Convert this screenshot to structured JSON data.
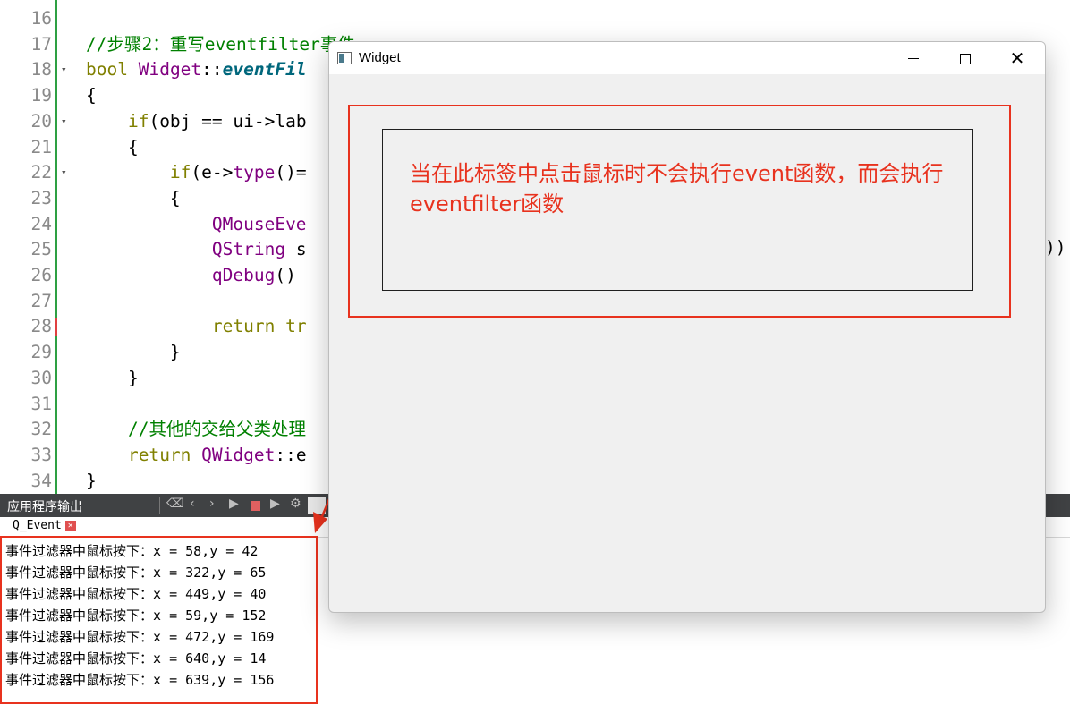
{
  "editor": {
    "lines": [
      {
        "n": "16",
        "fold": "",
        "parts": []
      },
      {
        "n": "17",
        "fold": "",
        "parts": [
          {
            "c": "cm",
            "t": "//步骤2：重写eventfilter事件"
          }
        ]
      },
      {
        "n": "18",
        "fold": "▾",
        "parts": [
          {
            "c": "kw",
            "t": "bool"
          },
          {
            "c": "op",
            "t": " "
          },
          {
            "c": "ty",
            "t": "Widget"
          },
          {
            "c": "op",
            "t": "::"
          },
          {
            "c": "fn",
            "t": "eventFil"
          }
        ]
      },
      {
        "n": "19",
        "fold": "",
        "parts": [
          {
            "c": "op",
            "t": "{"
          }
        ]
      },
      {
        "n": "20",
        "fold": "▾",
        "parts": [
          {
            "c": "op",
            "t": "    "
          },
          {
            "c": "kw",
            "t": "if"
          },
          {
            "c": "op",
            "t": "(obj == ui->lab"
          }
        ]
      },
      {
        "n": "21",
        "fold": "",
        "parts": [
          {
            "c": "op",
            "t": "    {"
          }
        ]
      },
      {
        "n": "22",
        "fold": "▾",
        "parts": [
          {
            "c": "op",
            "t": "        "
          },
          {
            "c": "kw",
            "t": "if"
          },
          {
            "c": "op",
            "t": "(e->"
          },
          {
            "c": "ty",
            "t": "type"
          },
          {
            "c": "op",
            "t": "()="
          }
        ]
      },
      {
        "n": "23",
        "fold": "",
        "parts": [
          {
            "c": "op",
            "t": "        {"
          }
        ]
      },
      {
        "n": "24",
        "fold": "",
        "parts": [
          {
            "c": "op",
            "t": "            "
          },
          {
            "c": "ty",
            "t": "QMouseEve"
          }
        ]
      },
      {
        "n": "25",
        "fold": "",
        "parts": [
          {
            "c": "op",
            "t": "            "
          },
          {
            "c": "ty",
            "t": "QString"
          },
          {
            "c": "op",
            "t": " s"
          }
        ]
      },
      {
        "n": "26",
        "fold": "",
        "parts": [
          {
            "c": "op",
            "t": "            "
          },
          {
            "c": "ty",
            "t": "qDebug"
          },
          {
            "c": "op",
            "t": "()"
          }
        ]
      },
      {
        "n": "27",
        "fold": "",
        "parts": []
      },
      {
        "n": "28",
        "fold": "",
        "parts": [
          {
            "c": "op",
            "t": "            "
          },
          {
            "c": "kw",
            "t": "return"
          },
          {
            "c": "op",
            "t": " "
          },
          {
            "c": "kw",
            "t": "tr"
          }
        ]
      },
      {
        "n": "29",
        "fold": "",
        "parts": [
          {
            "c": "op",
            "t": "        }"
          }
        ]
      },
      {
        "n": "30",
        "fold": "",
        "parts": [
          {
            "c": "op",
            "t": "    }"
          }
        ]
      },
      {
        "n": "31",
        "fold": "",
        "parts": []
      },
      {
        "n": "32",
        "fold": "",
        "parts": [
          {
            "c": "op",
            "t": "    "
          },
          {
            "c": "cm",
            "t": "//其他的交给父类处理"
          }
        ]
      },
      {
        "n": "33",
        "fold": "",
        "parts": [
          {
            "c": "op",
            "t": "    "
          },
          {
            "c": "kw",
            "t": "return"
          },
          {
            "c": "op",
            "t": " "
          },
          {
            "c": "ty",
            "t": "QWidget"
          },
          {
            "c": "op",
            "t": "::e"
          }
        ]
      },
      {
        "n": "34",
        "fold": "",
        "parts": [
          {
            "c": "op",
            "t": "}"
          }
        ]
      }
    ],
    "line25_tail": "))"
  },
  "output": {
    "title": "应用程序输出",
    "tab_label": "Q_Event",
    "tab_close": "✕",
    "lines": [
      "事件过滤器中鼠标按下：x = 58,y = 42",
      "事件过滤器中鼠标按下：x = 322,y = 65",
      "事件过滤器中鼠标按下：x = 449,y = 40",
      "事件过滤器中鼠标按下：x = 59,y = 152",
      "事件过滤器中鼠标按下：x = 472,y = 169",
      "事件过滤器中鼠标按下：x = 640,y = 14",
      "事件过滤器中鼠标按下：x = 639,y = 156"
    ]
  },
  "window": {
    "title": "Widget",
    "close_glyph": "✕",
    "label_text": "当在此标签中点击鼠标时不会执行event函数，而会执行eventfilter函数"
  },
  "colors": {
    "annotation_red": "#e8321e",
    "comment_green": "#008000",
    "keyword_olive": "#808000",
    "type_purple": "#800080"
  }
}
